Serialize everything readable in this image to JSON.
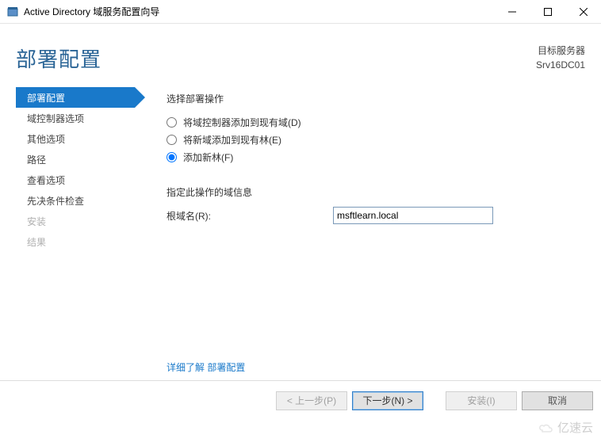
{
  "window": {
    "title": "Active Directory 域服务配置向导"
  },
  "header": {
    "page_title": "部署配置",
    "target_label": "目标服务器",
    "target_server": "Srv16DC01"
  },
  "sidebar": {
    "items": [
      {
        "label": "部署配置",
        "state": "active"
      },
      {
        "label": "域控制器选项",
        "state": "normal"
      },
      {
        "label": "其他选项",
        "state": "normal"
      },
      {
        "label": "路径",
        "state": "normal"
      },
      {
        "label": "查看选项",
        "state": "normal"
      },
      {
        "label": "先决条件检查",
        "state": "normal"
      },
      {
        "label": "安装",
        "state": "disabled"
      },
      {
        "label": "结果",
        "state": "disabled"
      }
    ]
  },
  "content": {
    "select_op_label": "选择部署操作",
    "radios": [
      {
        "label": "将域控制器添加到现有域(D)",
        "checked": false
      },
      {
        "label": "将新域添加到现有林(E)",
        "checked": false
      },
      {
        "label": "添加新林(F)",
        "checked": true
      }
    ],
    "domain_info_label": "指定此操作的域信息",
    "root_domain_label": "根域名(R):",
    "root_domain_value": "msftlearn.local",
    "learn_more_prefix": "详细了解 ",
    "learn_more_link": "部署配置"
  },
  "footer": {
    "prev": "< 上一步(P)",
    "next": "下一步(N) >",
    "install": "安装(I)",
    "cancel": "取消"
  },
  "watermark": "亿速云"
}
